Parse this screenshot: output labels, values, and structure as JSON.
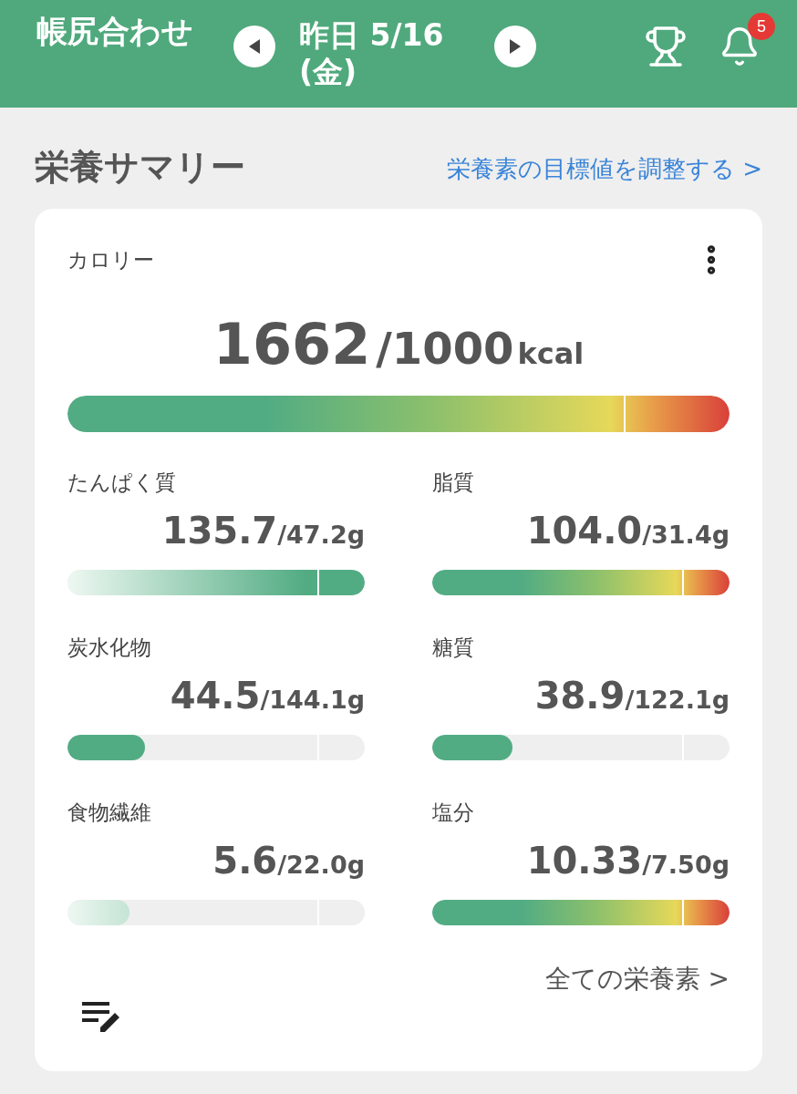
{
  "header": {
    "title": "帳尻合わせ",
    "date": "昨日 5/16 (金)",
    "notification_count": "5"
  },
  "summary": {
    "title": "栄養サマリー",
    "link": "栄養素の目標値を調整する >"
  },
  "calorie": {
    "label": "カロリー",
    "value": "1662",
    "target": "/1000",
    "unit": "kcal",
    "level": 1,
    "kind": "over"
  },
  "nutrients": [
    {
      "label": "たんぱく質",
      "value": "135.7",
      "target": "/47.2g",
      "level": 1,
      "kind": "fade"
    },
    {
      "label": "脂質",
      "value": "104.0",
      "target": "/31.4g",
      "level": 1,
      "kind": "over"
    },
    {
      "label": "炭水化物",
      "value": "44.5",
      "target": "/144.1g",
      "level": 0.26,
      "kind": "solid"
    },
    {
      "label": "糖質",
      "value": "38.9",
      "target": "/122.1g",
      "level": 0.27,
      "kind": "solid"
    },
    {
      "label": "食物繊維",
      "value": "5.6",
      "target": "/22.0g",
      "level": 0.21,
      "kind": "fade"
    },
    {
      "label": "塩分",
      "value": "10.33",
      "target": "/7.50g",
      "level": 1,
      "kind": "over"
    }
  ],
  "all_link": "全ての栄養素 >"
}
